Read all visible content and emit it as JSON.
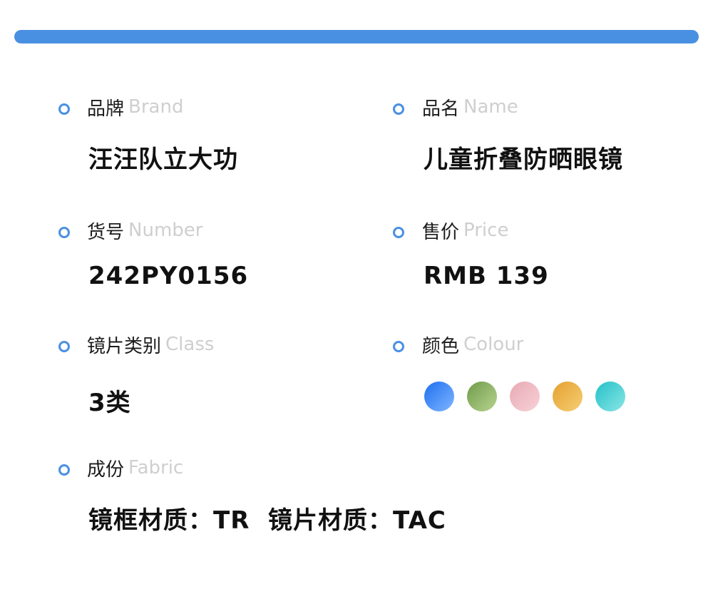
{
  "fields": {
    "brand": {
      "label_cn": "品牌",
      "label_en": "Brand",
      "value": "汪汪队立大功"
    },
    "name": {
      "label_cn": "品名",
      "label_en": "Name",
      "value": "儿童折叠防晒眼镜"
    },
    "number": {
      "label_cn": "货号",
      "label_en": "Number",
      "value": "242PY0156"
    },
    "price": {
      "label_cn": "售价",
      "label_en": "Price",
      "value": "RMB 139"
    },
    "class": {
      "label_cn": "镜片类别",
      "label_en": "Class",
      "value": "3类"
    },
    "colour": {
      "label_cn": "颜色",
      "label_en": "Colour"
    },
    "fabric": {
      "label_cn": "成份",
      "label_en": "Fabric",
      "value": "镜框材质：TR  镜片材质：TAC"
    }
  },
  "colours": [
    {
      "from": "#1e6ff0",
      "to": "#7fb6ff"
    },
    {
      "from": "#6f9a4a",
      "to": "#b7d48f"
    },
    {
      "from": "#e8a9b4",
      "to": "#f7d2d7"
    },
    {
      "from": "#e5a030",
      "to": "#f5cf74"
    },
    {
      "from": "#22c1c7",
      "to": "#8ce6e6"
    }
  ],
  "accent_color": "#4a90e2"
}
